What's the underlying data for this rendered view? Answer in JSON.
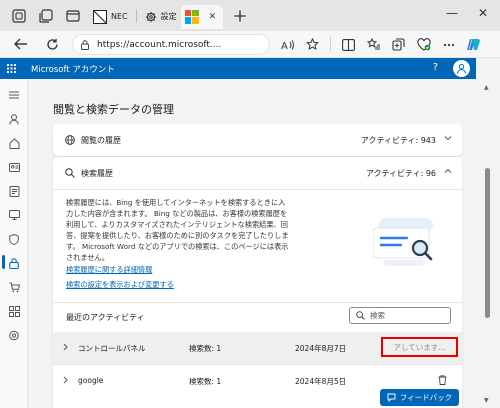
{
  "browser": {
    "tabs": [
      {
        "label": "NEC"
      },
      {
        "label": "設定"
      },
      {
        "label": ""
      }
    ],
    "address": {
      "url": "https://account.microsoft...."
    }
  },
  "header": {
    "title": "Microsoft アカウント",
    "help": "?"
  },
  "page": {
    "title": "閲覧と検索データの管理"
  },
  "browsing_history": {
    "label": "閲覧の履歴",
    "activity": "アクティビティ: 943"
  },
  "search_history": {
    "label": "検索履歴",
    "activity": "アクティビティ: 96",
    "description": "検索履歴には、Bing を使用してインターネットを検索するときに入力した内容が含まれます。 Bing などの製品は、お客様の検索履歴を利用して、よりカスタマイズされたインテリジェントな検索結果、回答、提案を提供したり、お客様のために別のタスクを完了したりします。 Microsoft Word などのアプリでの検索は、このページには表示されません。",
    "link_details": "検索履歴に関する詳細情報",
    "link_settings": "検索の設定を表示および変更する"
  },
  "recent": {
    "title": "最近のアクティビティ",
    "search_placeholder": "検索",
    "rows": [
      {
        "name": "コントロールパネル",
        "count": "検索数: 1",
        "date": "2024年8月7日",
        "status": "アしています..."
      },
      {
        "name": "google",
        "count": "検索数: 1",
        "date": "2024年8月5日"
      }
    ]
  },
  "feedback": {
    "label": "フィードバック"
  },
  "colors": {
    "accent": "#0067b8",
    "highlight_border": "#e00000"
  }
}
